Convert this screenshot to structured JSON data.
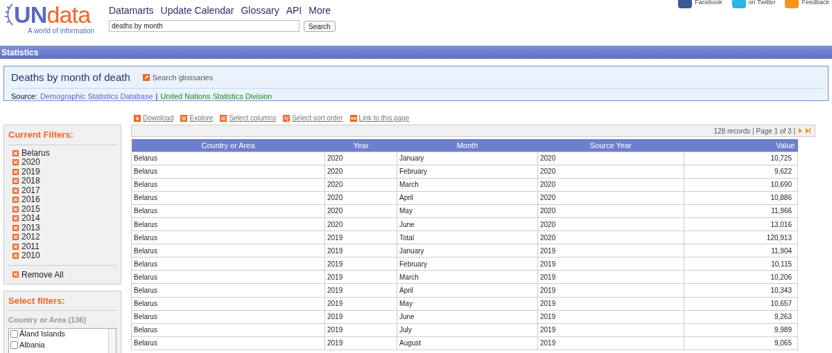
{
  "logo": {
    "name_left": "UN",
    "name_right": "data",
    "tagline": "A world of information"
  },
  "nav": [
    "Datamarts",
    "Update Calendar",
    "Glossary",
    "API",
    "More"
  ],
  "search": {
    "value": "deaths by month",
    "button": "Search"
  },
  "social": [
    "Facebook",
    "on Twitter",
    "Feedback"
  ],
  "section_bar": "Statistics",
  "dataset": {
    "title": "Deaths by month of death",
    "glossary_link": "Search glossaries",
    "source_label": "Source:",
    "source_link": "Demographic Statistics Database",
    "separator": "|",
    "agency_link": "United Nations Statistics Division"
  },
  "actions": [
    {
      "kind": "download",
      "label": "Download"
    },
    {
      "kind": "explore",
      "label": "Explore"
    },
    {
      "kind": "columns",
      "label": "Select columns"
    },
    {
      "kind": "sort",
      "label": "Select sort order"
    },
    {
      "kind": "link",
      "label": "Link to this page"
    }
  ],
  "pager": {
    "summary": "128 records | Page 1 of 3 |"
  },
  "current_filters": {
    "title": "Current Filters:",
    "items": [
      "Belarus",
      "2020",
      "2019",
      "2018",
      "2017",
      "2016",
      "2015",
      "2014",
      "2013",
      "2012",
      "2011",
      "2010"
    ],
    "remove_all": "Remove All"
  },
  "select_filters": {
    "title": "Select filters:",
    "group": "Country or Area (136)",
    "options": [
      {
        "label": "Åland Islands",
        "checked": false
      },
      {
        "label": "Albania",
        "checked": false
      }
    ]
  },
  "table": {
    "columns": [
      "Country or Area",
      "Year",
      "Month",
      "Source Year",
      "Value"
    ],
    "rows": [
      [
        "Belarus",
        "2020",
        "January",
        "2020",
        "10,725"
      ],
      [
        "Belarus",
        "2020",
        "February",
        "2020",
        "9,622"
      ],
      [
        "Belarus",
        "2020",
        "March",
        "2020",
        "10,690"
      ],
      [
        "Belarus",
        "2020",
        "April",
        "2020",
        "10,886"
      ],
      [
        "Belarus",
        "2020",
        "May",
        "2020",
        "11,966"
      ],
      [
        "Belarus",
        "2020",
        "June",
        "2020",
        "13,016"
      ],
      [
        "Belarus",
        "2019",
        "Total",
        "2020",
        "120,913"
      ],
      [
        "Belarus",
        "2019",
        "January",
        "2019",
        "11,904"
      ],
      [
        "Belarus",
        "2019",
        "February",
        "2019",
        "10,115"
      ],
      [
        "Belarus",
        "2019",
        "March",
        "2019",
        "10,206"
      ],
      [
        "Belarus",
        "2019",
        "April",
        "2019",
        "10,343"
      ],
      [
        "Belarus",
        "2019",
        "May",
        "2019",
        "10,657"
      ],
      [
        "Belarus",
        "2019",
        "June",
        "2019",
        "9,263"
      ],
      [
        "Belarus",
        "2019",
        "July",
        "2019",
        "9,989"
      ],
      [
        "Belarus",
        "2019",
        "August",
        "2019",
        "9,065"
      ]
    ]
  }
}
